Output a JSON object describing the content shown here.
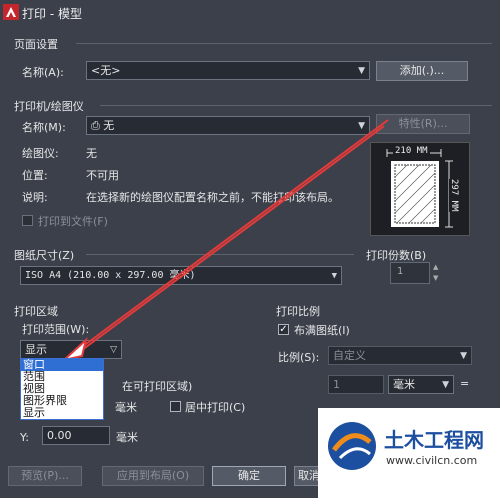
{
  "window": {
    "title": "打印 - 模型"
  },
  "page_setup": {
    "group_label": "页面设置",
    "name_label": "名称(A):",
    "name_value": "<无>",
    "add_button": "添加(.)..."
  },
  "printer": {
    "group_label": "打印机/绘图仪",
    "name_label": "名称(M):",
    "name_value": "无",
    "properties_button": "特性(R)...",
    "plotter_label": "绘图仪:",
    "plotter_value": "无",
    "location_label": "位置:",
    "location_value": "不可用",
    "description_label": "说明:",
    "description_value": "在选择新的绘图仪配置名称之前，不能打印该布局。",
    "print_to_file_label": "打印到文件(F)",
    "preview_width": "210 MM",
    "preview_height": "297 MM"
  },
  "paper_size": {
    "group_label": "图纸尺寸(Z)",
    "value": "ISO A4 (210.00 x 297.00 毫米)"
  },
  "copies": {
    "group_label": "打印份数(B)",
    "value": "1"
  },
  "plot_area": {
    "group_label": "打印区域",
    "range_label": "打印范围(W):",
    "range_value": "显示",
    "options": [
      "窗口",
      "范围",
      "视图",
      "图形界限",
      "显示"
    ],
    "selected_option": "窗口"
  },
  "plot_offset": {
    "group_label_partial": "在可打印区域)",
    "x_unit": "毫米",
    "center_label": "居中打印(C)",
    "y_label": "Y:",
    "y_value": "0.00",
    "y_unit": "毫米"
  },
  "plot_scale": {
    "group_label": "打印比例",
    "fit_label": "布满图纸(I)",
    "fit_checked": true,
    "scale_label": "比例(S):",
    "scale_value": "自定义",
    "scale_num": "1",
    "unit": "毫米",
    "eq": "="
  },
  "footer": {
    "preview_button": "预览(P)...",
    "apply_button": "应用到布局(O)",
    "ok_button": "确定",
    "cancel_button": "取消"
  },
  "watermark": {
    "name": "土木工程网",
    "url": "www.civilcn.com"
  },
  "colors": {
    "dialog_bg": "#3b404b",
    "arrow_red": "#e23b3b",
    "selection_blue": "#2f6ed3",
    "watermark_blue": "#1d4fa0",
    "watermark_orange": "#f08c1a"
  }
}
